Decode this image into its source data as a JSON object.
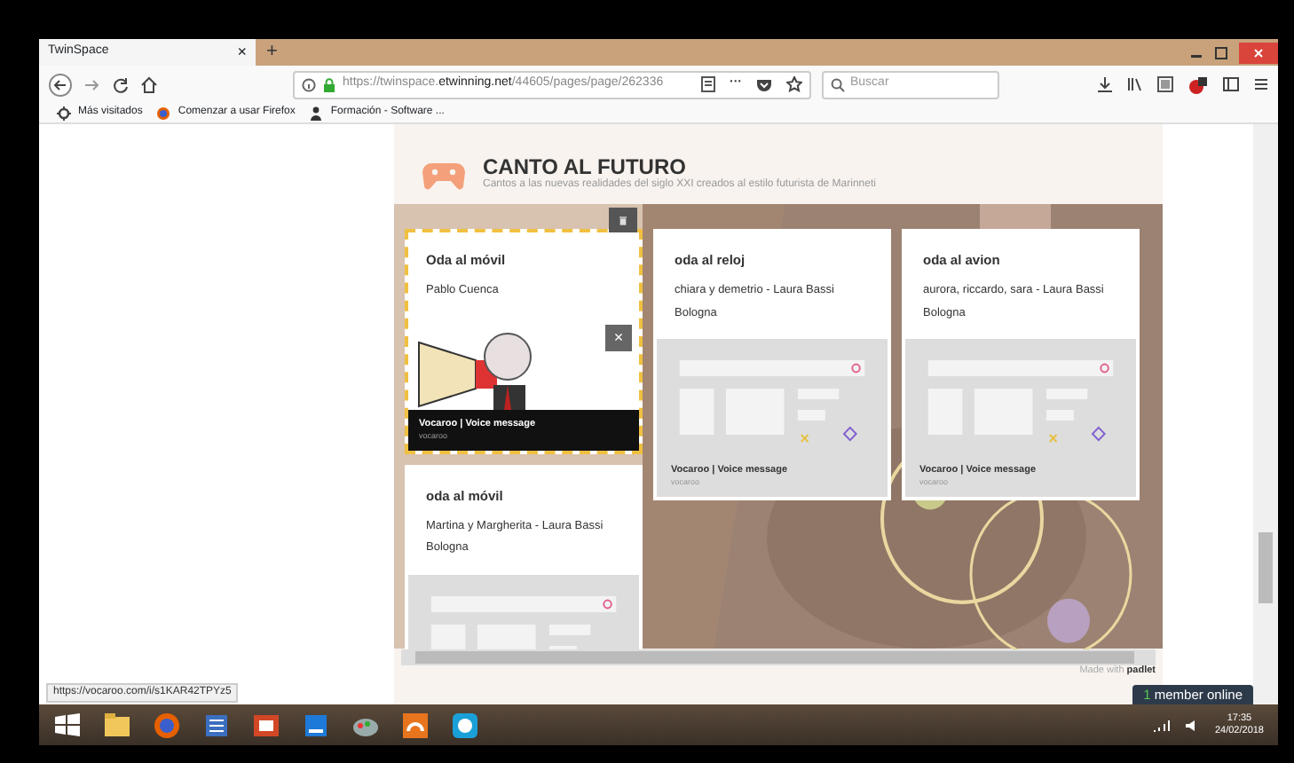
{
  "browser": {
    "tab_title": "TwinSpace",
    "tab_close": "×",
    "new_tab": "+",
    "url_prefix": "https://twinspace.",
    "url_domain": "etwinning.net",
    "url_path": "/44605/pages/page/262336",
    "more": "···",
    "search_placeholder": "Buscar",
    "bookmarks": [
      "Más visitados",
      "Comenzar a usar Firefox",
      "Formación - Software ..."
    ]
  },
  "padlet": {
    "title": "CANTO AL FUTURO",
    "subtitle": "Cantos a las nuevas realidades del siglo XXI creados al estilo futurista de Marinneti",
    "footer_prefix": "Made with",
    "footer_brand": "padlet",
    "columns": [
      [
        {
          "title": "Oda al móvil",
          "body": "Pablo Cuenca",
          "selected": true,
          "attachment": {
            "close": "×",
            "title": "Vocaroo | Voice message",
            "source": "vocaroo"
          }
        },
        {
          "title": "oda al móvil",
          "body": "Martina y Margherita  - Laura Bassi Bologna",
          "selected": false,
          "attachment": {
            "kind": "preview"
          }
        }
      ],
      [
        {
          "title": "oda al reloj",
          "body": "chiara y demetrio - Laura Bassi Bologna",
          "selected": false,
          "attachment": {
            "kind": "preview",
            "title": "Vocaroo | Voice message",
            "source": "vocaroo"
          }
        }
      ],
      [
        {
          "title": "oda al avion",
          "body": "aurora, riccardo, sara  - Laura Bassi Bologna",
          "selected": false,
          "attachment": {
            "kind": "preview",
            "title": "Vocaroo | Voice message",
            "source": "vocaroo"
          }
        }
      ]
    ]
  },
  "status_url": "https://vocaroo.com/i/s1KAR42TPYz5",
  "member_badge": {
    "count": "1",
    "label": "member online"
  },
  "taskbar": {
    "time": "17:35",
    "date": "24/02/2018"
  }
}
